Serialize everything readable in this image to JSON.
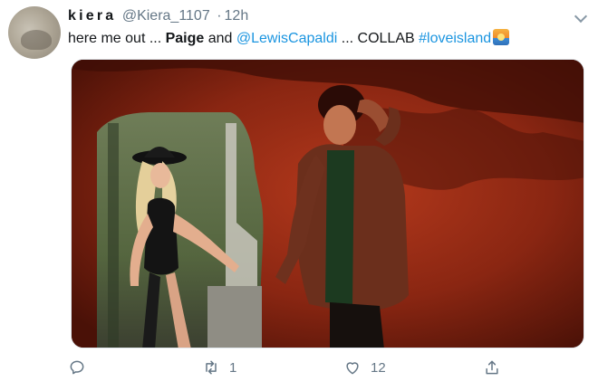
{
  "user": {
    "display_name": "kiera",
    "handle": "@Kiera_1107",
    "separator": "·",
    "timestamp": "12h"
  },
  "tweet": {
    "text_part1": "here me out ... ",
    "bold_name": "Paige",
    "text_part2": " and ",
    "mention": "@LewisCapaldi",
    "text_part3": " ... COLLAB  ",
    "hashtag": "#loveisland",
    "emoji": "sunset-emoji"
  },
  "actions": {
    "reply_icon": "reply-icon",
    "retweet_icon": "retweet-icon",
    "retweet_count": "1",
    "like_icon": "heart-icon",
    "like_count": "12",
    "share_icon": "share-icon"
  },
  "colors": {
    "link": "#1b95e0",
    "secondary_text": "#657786",
    "media_background": "#6e1d0c"
  }
}
